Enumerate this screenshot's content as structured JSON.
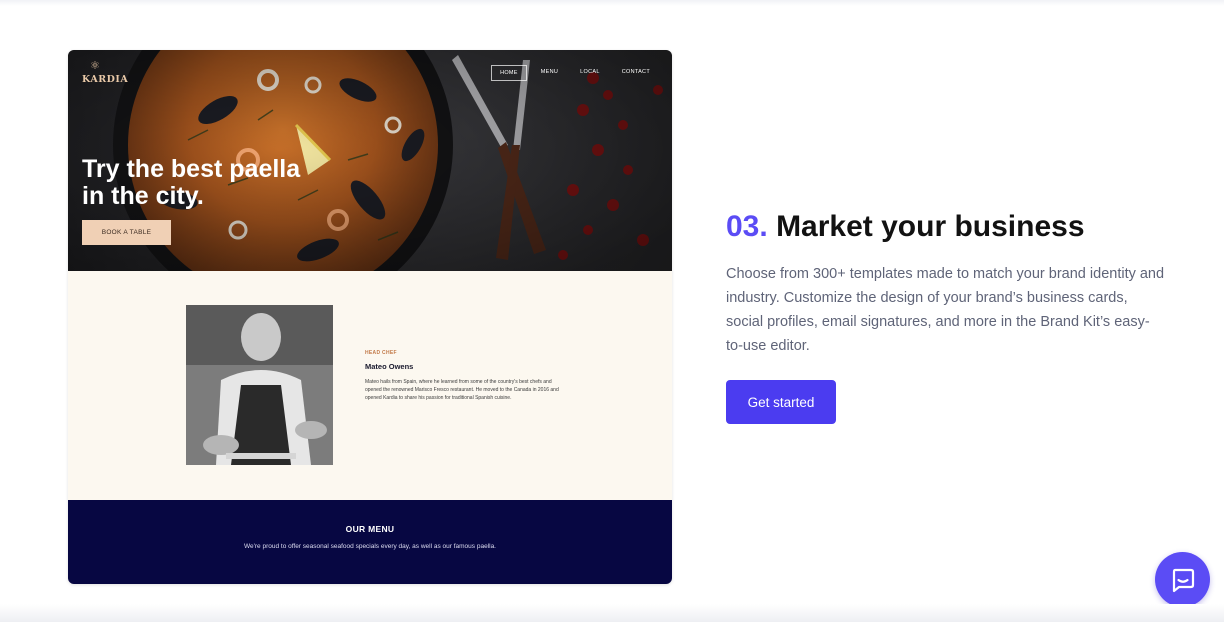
{
  "mockup": {
    "brand": {
      "icon": "fish-icon",
      "name": "KARDIA"
    },
    "nav": {
      "items": [
        {
          "label": "HOME",
          "active": true
        },
        {
          "label": "MENU"
        },
        {
          "label": "LOCAL"
        },
        {
          "label": "CONTACT"
        }
      ]
    },
    "hero": {
      "title_line1": "Try the best paella",
      "title_line2": "in the city.",
      "cta_label": "BOOK A TABLE"
    },
    "about": {
      "label": "HEAD CHEF",
      "name": "Mateo Owens",
      "bio": "Mateo hails from Spain, where he learned from some of the country's best chefs and opened the renowned Marisco Fresco restaurant. He moved to the Canada in 2016 and opened Kardia to share his passion for traditional Spanish cuisine."
    },
    "menu_section": {
      "title": "OUR MENU",
      "text": "We're proud to offer seasonal seafood specials every day, as well as our famous paella."
    }
  },
  "feature": {
    "number": "03.",
    "title": "Market your business",
    "body": "Choose from 300+ templates made to match your brand identity and industry. Customize the design of your brand’s business cards, social profiles, email signatures, and more in the Brand Kit’s easy-to-use editor.",
    "cta_label": "Get started"
  },
  "chat": {
    "icon": "chat-icon"
  },
  "colors": {
    "accent": "#5b4cf5",
    "button": "#4b3cf0",
    "navy": "#070742",
    "cream": "#fcf8f0",
    "peach": "#f0d0b5"
  }
}
